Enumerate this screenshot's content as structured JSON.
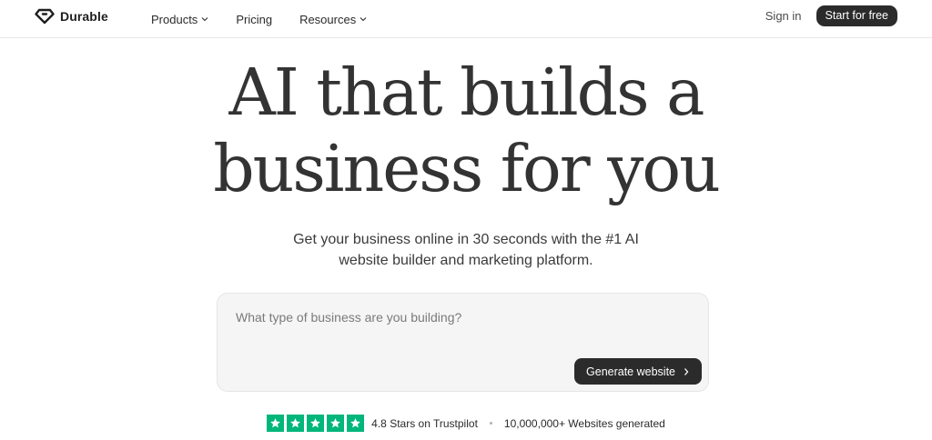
{
  "header": {
    "brand": "Durable",
    "nav": [
      {
        "label": "Products",
        "has_dropdown": true
      },
      {
        "label": "Pricing",
        "has_dropdown": false
      },
      {
        "label": "Resources",
        "has_dropdown": true
      }
    ],
    "sign_in": "Sign in",
    "start_cta": "Start for free"
  },
  "hero": {
    "title_line1": "AI that builds a",
    "title_line2": "business for you",
    "subtitle_line1": "Get your business online in 30 seconds with the #1 AI",
    "subtitle_line2": "website builder and marketing platform."
  },
  "prompt": {
    "placeholder": "What type of business are you building?",
    "button_label": "Generate website"
  },
  "trust": {
    "star_count": 5,
    "rating_text": "4.8 Stars on Trustpilot",
    "websites_text": "10,000,000+ Websites generated"
  },
  "colors": {
    "dark": "#2b2b2b",
    "trustpilot_green": "#00b67a",
    "prompt_bg": "#f5f5f5"
  },
  "icons": {
    "brand": "diamond-logo-icon",
    "dropdown": "chevron-down-icon",
    "button_arrow": "chevron-right-icon",
    "rating": "star-icon"
  }
}
